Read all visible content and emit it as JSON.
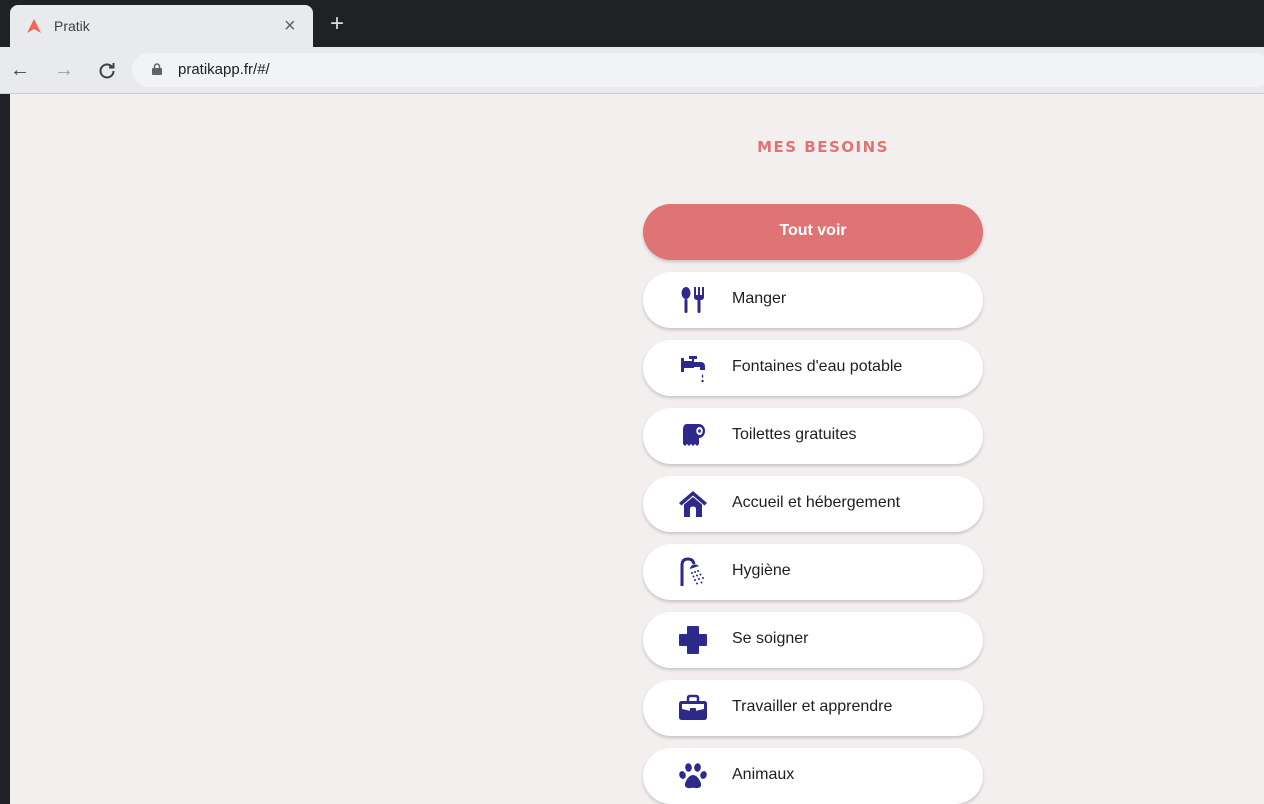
{
  "browser": {
    "tab_title": "Pratik",
    "tab_close": "×",
    "new_tab": "+",
    "back": "←",
    "forward": "→",
    "reload": "C",
    "url": "pratikapp.fr/#/"
  },
  "page": {
    "heading": "MES BESOINS",
    "accent_color": "#e07475",
    "icon_color": "#2e2a8c",
    "categories": [
      {
        "label": "Tout voir",
        "icon": null
      },
      {
        "label": "Manger",
        "icon": "utensils-icon"
      },
      {
        "label": "Fontaines d'eau potable",
        "icon": "water-tap-icon"
      },
      {
        "label": "Toilettes gratuites",
        "icon": "toilet-paper-icon"
      },
      {
        "label": "Accueil et hébergement",
        "icon": "house-icon"
      },
      {
        "label": "Hygiène",
        "icon": "shower-icon"
      },
      {
        "label": "Se soigner",
        "icon": "medical-cross-icon"
      },
      {
        "label": "Travailler et apprendre",
        "icon": "briefcase-icon"
      },
      {
        "label": "Animaux",
        "icon": "paw-icon"
      }
    ]
  }
}
